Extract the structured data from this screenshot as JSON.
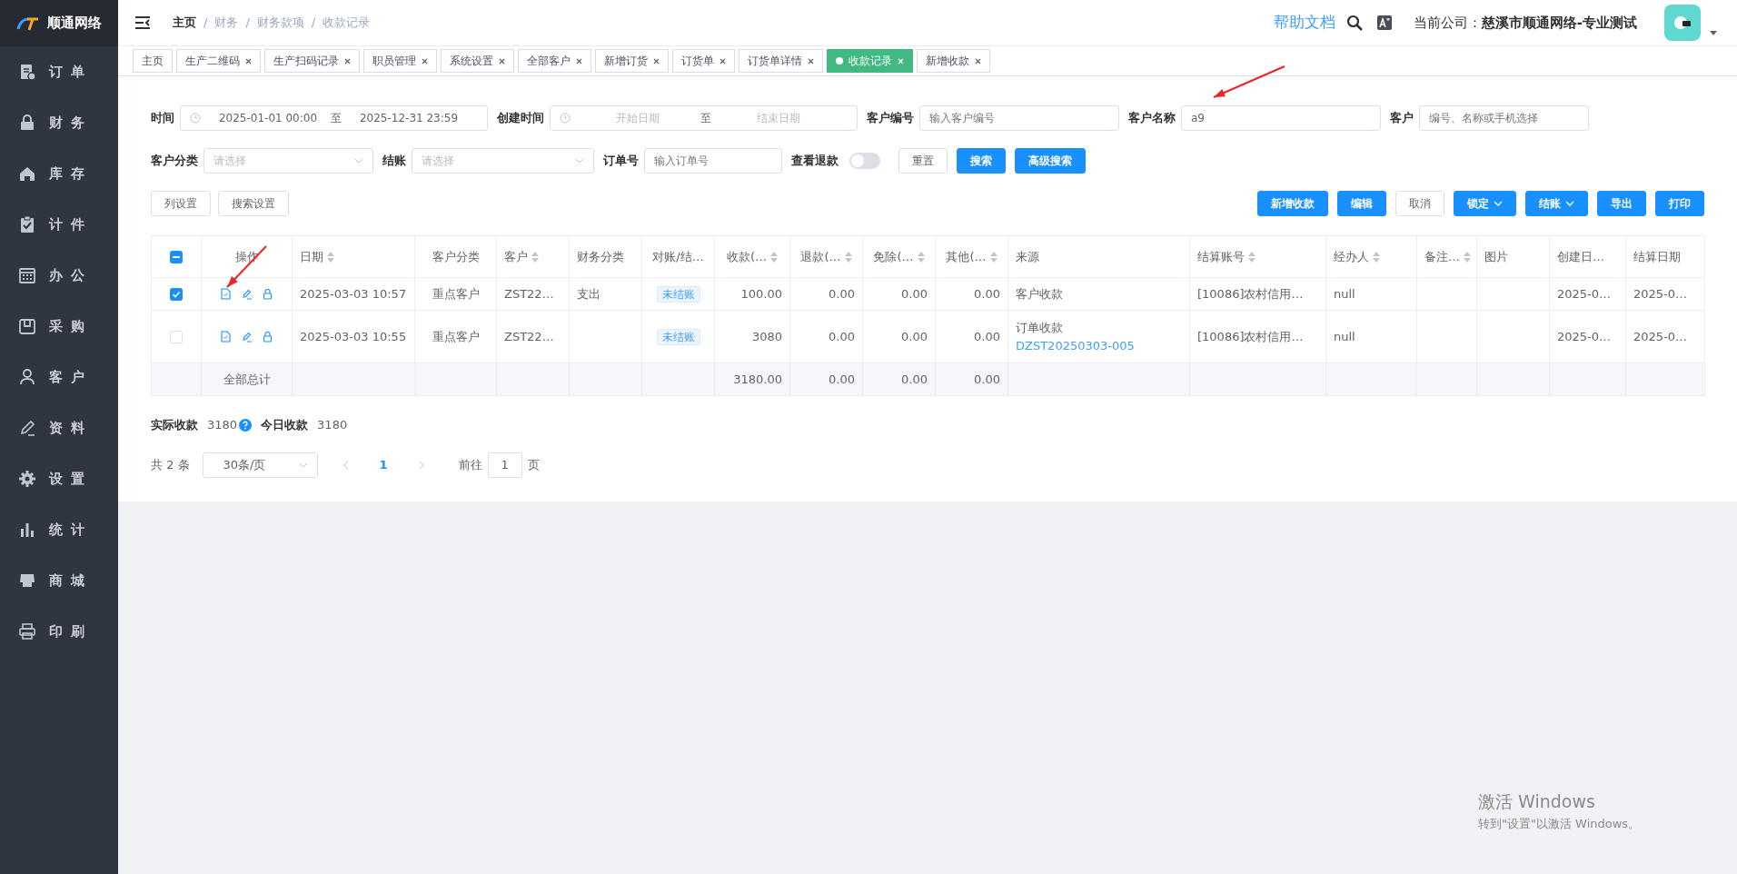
{
  "brand": {
    "name": "顺通网络"
  },
  "sidebar": {
    "items": [
      {
        "label": "订单"
      },
      {
        "label": "财务"
      },
      {
        "label": "库存"
      },
      {
        "label": "计件"
      },
      {
        "label": "办公"
      },
      {
        "label": "采购"
      },
      {
        "label": "客户"
      },
      {
        "label": "资料"
      },
      {
        "label": "设置"
      },
      {
        "label": "统计"
      },
      {
        "label": "商城"
      },
      {
        "label": "印刷"
      }
    ]
  },
  "header": {
    "breadcrumb": [
      {
        "label": "主页"
      },
      {
        "label": "财务"
      },
      {
        "label": "财务款项"
      },
      {
        "label": "收款记录"
      }
    ],
    "separator": "/",
    "help_link": "帮助文档",
    "company_label": "当前公司：",
    "company": "慈溪市顺通网络-专业测试"
  },
  "tabs": [
    {
      "label": "主页",
      "selected": false,
      "closable": false
    },
    {
      "label": "生产二维码",
      "selected": false,
      "closable": true
    },
    {
      "label": "生产扫码记录",
      "selected": false,
      "closable": true
    },
    {
      "label": "职员管理",
      "selected": false,
      "closable": true
    },
    {
      "label": "系统设置",
      "selected": false,
      "closable": true
    },
    {
      "label": "全部客户",
      "selected": false,
      "closable": true
    },
    {
      "label": "新增订货",
      "selected": false,
      "closable": true
    },
    {
      "label": "订货单",
      "selected": false,
      "closable": true
    },
    {
      "label": "订货单详情",
      "selected": false,
      "closable": true
    },
    {
      "label": "收款记录",
      "selected": true,
      "closable": true
    },
    {
      "label": "新增收款",
      "selected": false,
      "closable": true
    }
  ],
  "filters": [
    [
      {
        "kind": "daterange",
        "label": "时间",
        "start_value": "2025-01-01 00:00",
        "separator": "至",
        "end_value": "2025-12-31 23:59"
      },
      {
        "kind": "daterange",
        "label": "创建时间",
        "start_placeholder": "开始日期",
        "separator": "至",
        "end_placeholder": "结束日期"
      },
      {
        "kind": "input",
        "label": "客户编号",
        "placeholder": "输入客户编号"
      },
      {
        "kind": "input",
        "label": "客户名称",
        "value": "a9"
      },
      {
        "kind": "input",
        "label": "客户",
        "placeholder": "编号、名称或手机选择"
      }
    ],
    [
      {
        "kind": "select",
        "label": "客户分类",
        "placeholder": "请选择"
      },
      {
        "kind": "select",
        "label": "结账",
        "placeholder": "请选择"
      },
      {
        "kind": "input",
        "label": "订单号",
        "placeholder": "输入订单号"
      },
      {
        "kind": "switch",
        "label": "查看退款",
        "on": false
      },
      {
        "kind": "button",
        "label": "重置",
        "primary": false
      },
      {
        "kind": "button",
        "label": "搜索",
        "primary": true
      },
      {
        "kind": "button",
        "label": "高级搜索",
        "primary": true
      }
    ]
  ],
  "toolbar": {
    "left": [
      {
        "label": "列设置",
        "primary": false,
        "dropdown": false
      },
      {
        "label": "搜索设置",
        "primary": false,
        "dropdown": false
      }
    ],
    "right": [
      {
        "label": "新增收款",
        "primary": true,
        "dropdown": false
      },
      {
        "label": "编辑",
        "primary": true,
        "dropdown": false
      },
      {
        "label": "取消",
        "primary": false,
        "dropdown": false
      },
      {
        "label": "锁定",
        "primary": true,
        "dropdown": true
      },
      {
        "label": "结账",
        "primary": true,
        "dropdown": true
      },
      {
        "label": "导出",
        "primary": true,
        "dropdown": false
      },
      {
        "label": "打印",
        "primary": true,
        "dropdown": false
      }
    ]
  },
  "table": {
    "header_checkbox": {
      "checked": false,
      "indeterminate": true
    },
    "columns": [
      {
        "kind": "check"
      },
      {
        "kind": "ops",
        "label": "操作",
        "sortable": false
      },
      {
        "kind": "text",
        "label": "日期",
        "sortable": true
      },
      {
        "kind": "text",
        "label": "客户分类",
        "sortable": false
      },
      {
        "kind": "text",
        "label": "客户",
        "sortable": true
      },
      {
        "kind": "text",
        "label": "财务分类",
        "sortable": false
      },
      {
        "kind": "tag",
        "label": "对账/结…",
        "sortable": false
      },
      {
        "kind": "num",
        "label": "收款(…",
        "sortable": true
      },
      {
        "kind": "num",
        "label": "退款(…",
        "sortable": true
      },
      {
        "kind": "num",
        "label": "免除(…",
        "sortable": true
      },
      {
        "kind": "num",
        "label": "其他(…",
        "sortable": true
      },
      {
        "kind": "source",
        "label": "来源",
        "sortable": false
      },
      {
        "kind": "text",
        "label": "结算账号",
        "sortable": true
      },
      {
        "kind": "text",
        "label": "经办人",
        "sortable": true
      },
      {
        "kind": "text",
        "label": "备注…",
        "sortable": true
      },
      {
        "kind": "text",
        "label": "图片",
        "sortable": false
      },
      {
        "kind": "text",
        "label": "创建日…",
        "sortable": false
      },
      {
        "kind": "text",
        "label": "结算日期",
        "sortable": false
      }
    ],
    "rows": [
      {
        "selected": true,
        "cells": [
          "",
          "",
          "2025-03-03 10:57",
          "重点客户",
          "ZST22…",
          "支出",
          "未结账",
          "100.00",
          "0.00",
          "0.00",
          "0.00",
          {
            "text": "客户收款"
          },
          "[10086]农村信用…",
          "null",
          "",
          "",
          "2025-0…",
          "2025-0…"
        ]
      },
      {
        "selected": false,
        "cells": [
          "",
          "",
          "2025-03-03 10:55",
          "重点客户",
          "ZST22…",
          "",
          "未结账",
          "3080",
          "0.00",
          "0.00",
          "0.00",
          {
            "text": "订单收款",
            "link": "DZST20250303-005"
          },
          "[10086]农村信用…",
          "null",
          "",
          "",
          "2025-0…",
          "2025-0…"
        ]
      }
    ],
    "totals": {
      "cells": [
        "",
        "全部总计",
        "",
        "",
        "",
        "",
        "",
        "3180.00",
        "0.00",
        "0.00",
        "0.00",
        "",
        "",
        "",
        "",
        "",
        "",
        ""
      ]
    }
  },
  "summary": [
    {
      "label": "实际收款",
      "value": "3180",
      "help": true
    },
    {
      "label": "今日收款",
      "value": "3180",
      "help": false
    }
  ],
  "pagination": {
    "total": "共 2 条",
    "page_size": "30条/页",
    "pages": [
      {
        "label": "1",
        "selected": true
      }
    ],
    "goto_label": "前往",
    "goto_value": "1",
    "goto_unit": "页"
  },
  "os_notice": {
    "title": "激活 Windows",
    "subtitle": "转到\"设置\"以激活 Windows。"
  }
}
